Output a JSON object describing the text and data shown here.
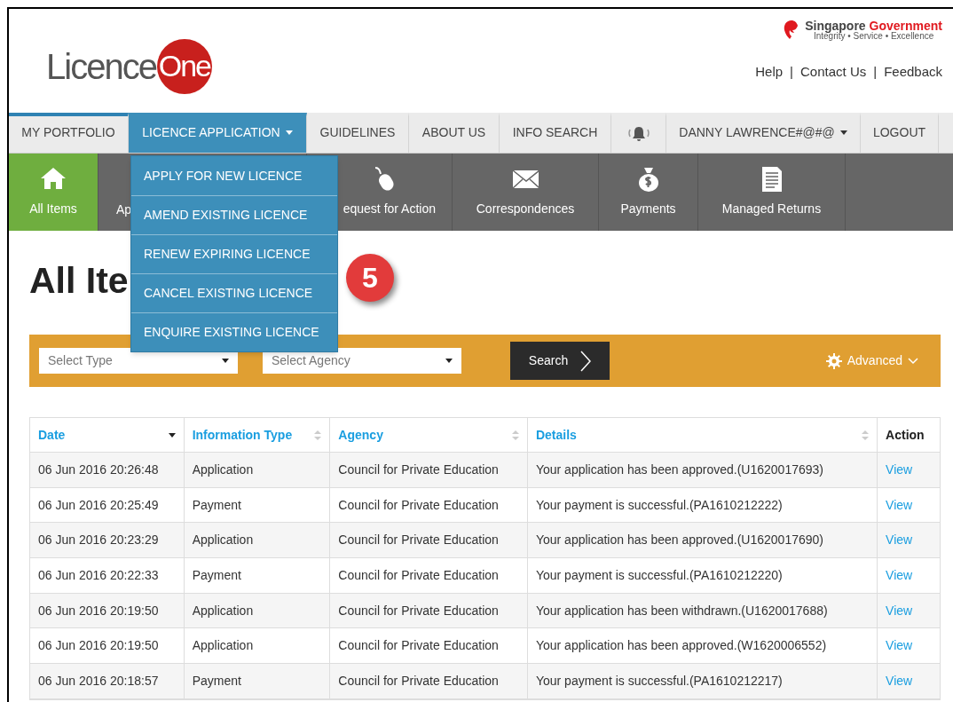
{
  "header": {
    "logo": {
      "text": "Licence",
      "badge": "One"
    },
    "government": {
      "name": "Singapore",
      "name_accent": "Government",
      "motto": "Integrity • Service • Excellence"
    },
    "links": [
      {
        "label": "Help"
      },
      {
        "label": "Contact Us"
      },
      {
        "label": "Feedback"
      }
    ],
    "separator": "|"
  },
  "nav": [
    {
      "kind": "text",
      "label": "MY PORTFOLIO",
      "selected": true,
      "expanded": false
    },
    {
      "kind": "text",
      "label": "LICENCE APPLICATION",
      "selected": false,
      "expanded": true,
      "caret": true
    },
    {
      "kind": "text",
      "label": "GUIDELINES",
      "selected": false,
      "expanded": false
    },
    {
      "kind": "text",
      "label": "ABOUT US",
      "selected": false,
      "expanded": false
    },
    {
      "kind": "text",
      "label": "INFO SEARCH",
      "selected": false,
      "expanded": false
    },
    {
      "kind": "bell",
      "selected": false,
      "expanded": false
    },
    {
      "kind": "text",
      "label": "DANNY LAWRENCE#@#@",
      "selected": false,
      "expanded": false,
      "caret": true
    },
    {
      "kind": "text",
      "label": "LOGOUT",
      "selected": false,
      "expanded": false
    }
  ],
  "dropdown": [
    {
      "label": "APPLY FOR NEW LICENCE"
    },
    {
      "label": "AMEND EXISTING LICENCE"
    },
    {
      "label": "RENEW EXPIRING LICENCE"
    },
    {
      "label": "CANCEL EXISTING LICENCE"
    },
    {
      "label": "ENQUIRE EXISTING LICENCE"
    }
  ],
  "subnav": [
    {
      "label": "All Items",
      "selected": true
    },
    {
      "label": "Ap",
      "selected": false
    },
    {
      "label": "equest for Action",
      "selected": false
    },
    {
      "label": "Correspondences",
      "selected": false
    },
    {
      "label": "Payments",
      "selected": false
    },
    {
      "label": "Managed Returns",
      "selected": false
    }
  ],
  "title": "All Ite",
  "step_badge": "5",
  "filters": {
    "type": {
      "placeholder": "Select Type"
    },
    "agency": {
      "placeholder": "Select Agency"
    },
    "search": "Search",
    "advanced": "Advanced"
  },
  "table": {
    "columns": [
      {
        "label": "Date",
        "kind": "sorted"
      },
      {
        "label": "Information Type",
        "kind": "sortable"
      },
      {
        "label": "Agency",
        "kind": "sortable"
      },
      {
        "label": "Details",
        "kind": "sortable"
      },
      {
        "label": "Action",
        "kind": "plain"
      }
    ],
    "rows": [
      [
        "06 Jun 2016 20:26:48",
        "Application",
        "Council for Private Education",
        "Your application has been approved.(U1620017693)",
        "View"
      ],
      [
        "06 Jun 2016 20:25:49",
        "Payment",
        "Council for Private Education",
        "Your payment is successful.(PA1610212222)",
        "View"
      ],
      [
        "06 Jun 2016 20:23:29",
        "Application",
        "Council for Private Education",
        "Your application has been approved.(U1620017690)",
        "View"
      ],
      [
        "06 Jun 2016 20:22:33",
        "Payment",
        "Council for Private Education",
        "Your payment is successful.(PA1610212220)",
        "View"
      ],
      [
        "06 Jun 2016 20:19:50",
        "Application",
        "Council for Private Education",
        "Your application has been withdrawn.(U1620017688)",
        "View"
      ],
      [
        "06 Jun 2016 20:19:50",
        "Application",
        "Council for Private Education",
        "Your application has been approved.(W1620006552)",
        "View"
      ],
      [
        "06 Jun 2016 20:18:57",
        "Payment",
        "Council for Private Education",
        "Your payment is successful.(PA1610212217)",
        "View"
      ]
    ]
  }
}
